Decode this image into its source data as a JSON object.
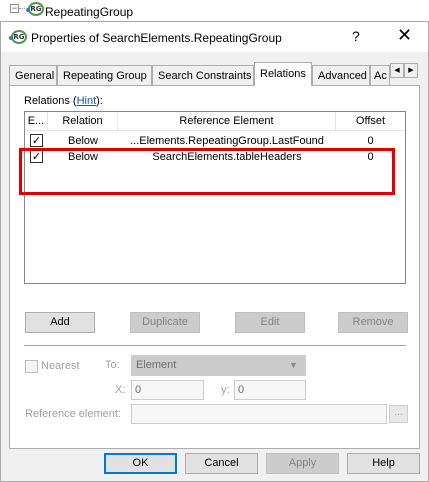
{
  "tree": {
    "toggle": "−",
    "node_label": "RepeatingGroup"
  },
  "dialog": {
    "title": "Properties of SearchElements.RepeatingGroup",
    "help": "?",
    "close": "✕"
  },
  "tabs": [
    {
      "label": "General",
      "active": false
    },
    {
      "label": "Repeating Group",
      "active": false
    },
    {
      "label": "Search Constraints",
      "active": false
    },
    {
      "label": "Relations",
      "active": true
    },
    {
      "label": "Advanced",
      "active": false
    },
    {
      "label": "Ac",
      "active": false
    }
  ],
  "tab_scroll": {
    "left": "◀",
    "right": "▶"
  },
  "relations": {
    "label_prefix": "Relations (",
    "hint_link": "Hint",
    "label_suffix": "):",
    "columns": [
      "E...",
      "Relation",
      "Reference Element",
      "Offset"
    ],
    "rows": [
      {
        "enabled": true,
        "check": "✓",
        "relation": "Below",
        "reference": "...Elements.RepeatingGroup.LastFound",
        "offset": "0"
      },
      {
        "enabled": true,
        "check": "✓",
        "relation": "Below",
        "reference": "SearchElements.tableHeaders",
        "offset": "0"
      }
    ]
  },
  "list_buttons": {
    "add": "Add",
    "duplicate": "Duplicate",
    "edit": "Edit",
    "remove": "Remove"
  },
  "details": {
    "nearest_label": "Nearest",
    "to_label": "To:",
    "to_value": "Element",
    "x_label": "X:",
    "x_value": "0",
    "y_label": "y:",
    "y_value": "0",
    "reference_label": "Reference element:",
    "reference_value": "",
    "browse": "..."
  },
  "footer_buttons": {
    "ok": "OK",
    "cancel": "Cancel",
    "apply": "Apply",
    "help": "Help"
  },
  "colors": {
    "highlight": "#e10000",
    "link": "#0b5cad",
    "default_button_border": "#0078d7",
    "dialog_bg": "#f0f0f0"
  }
}
